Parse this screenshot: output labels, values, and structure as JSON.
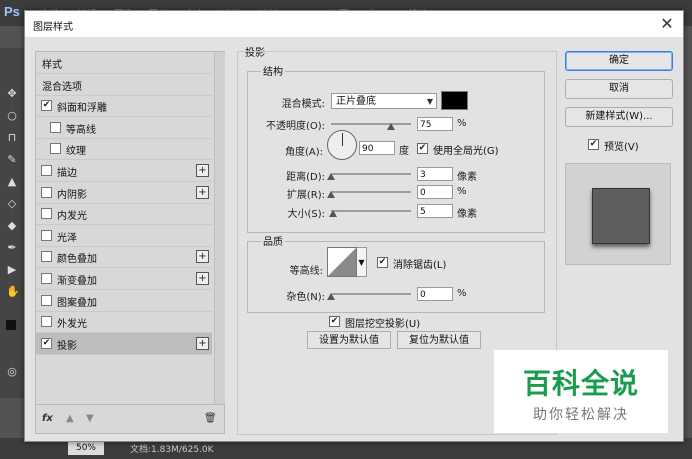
{
  "background_app": {
    "logo": "Ps",
    "menu": "文件(F)  编辑(E)  图像(I)  图层(L)  文字(Y)  选择(S)  滤镜(T)  3D(D)  视图(V)  窗口(W)  帮助(H)",
    "zoom": "50%",
    "doc_info": "文档:1.83M/625.0K"
  },
  "dialog": {
    "title": "图层样式",
    "close_glyph": "✕"
  },
  "sidebar": {
    "items": [
      {
        "label": "样式",
        "has_checkbox": false,
        "checked": false,
        "has_plus": false,
        "selected": false,
        "indent": false
      },
      {
        "label": "混合选项",
        "has_checkbox": false,
        "checked": false,
        "has_plus": false,
        "selected": false,
        "indent": false
      },
      {
        "label": "斜面和浮雕",
        "has_checkbox": true,
        "checked": true,
        "has_plus": false,
        "selected": false,
        "indent": false
      },
      {
        "label": "等高线",
        "has_checkbox": true,
        "checked": false,
        "has_plus": false,
        "selected": false,
        "indent": true
      },
      {
        "label": "纹理",
        "has_checkbox": true,
        "checked": false,
        "has_plus": false,
        "selected": false,
        "indent": true
      },
      {
        "label": "描边",
        "has_checkbox": true,
        "checked": false,
        "has_plus": true,
        "selected": false,
        "indent": false
      },
      {
        "label": "内阴影",
        "has_checkbox": true,
        "checked": false,
        "has_plus": true,
        "selected": false,
        "indent": false
      },
      {
        "label": "内发光",
        "has_checkbox": true,
        "checked": false,
        "has_plus": false,
        "selected": false,
        "indent": false
      },
      {
        "label": "光泽",
        "has_checkbox": true,
        "checked": false,
        "has_plus": false,
        "selected": false,
        "indent": false
      },
      {
        "label": "颜色叠加",
        "has_checkbox": true,
        "checked": false,
        "has_plus": true,
        "selected": false,
        "indent": false
      },
      {
        "label": "渐变叠加",
        "has_checkbox": true,
        "checked": false,
        "has_plus": true,
        "selected": false,
        "indent": false
      },
      {
        "label": "图案叠加",
        "has_checkbox": true,
        "checked": false,
        "has_plus": false,
        "selected": false,
        "indent": false
      },
      {
        "label": "外发光",
        "has_checkbox": true,
        "checked": false,
        "has_plus": false,
        "selected": false,
        "indent": false
      },
      {
        "label": "投影",
        "has_checkbox": true,
        "checked": true,
        "has_plus": true,
        "selected": true,
        "indent": false
      }
    ],
    "footer": {
      "fx": "fx",
      "up": "▲",
      "down": "▼",
      "trash": "🗑"
    }
  },
  "panel": {
    "section_title": "投影",
    "structure": {
      "title": "结构",
      "blend_mode_label": "混合模式:",
      "blend_mode_value": "正片叠底",
      "shadow_color": "#000000",
      "opacity_label": "不透明度(O):",
      "opacity_value": "75",
      "opacity_fraction": 0.75,
      "opacity_unit": "%",
      "angle_label": "角度(A):",
      "angle_value": "90",
      "angle_unit": "度",
      "global_light_label": "使用全局光(G)",
      "global_light_checked": true,
      "distance_label": "距离(D):",
      "distance_value": "3",
      "distance_unit": "像素",
      "spread_label": "扩展(R):",
      "spread_value": "0",
      "spread_unit": "%",
      "size_label": "大小(S):",
      "size_value": "5",
      "size_unit": "像素"
    },
    "quality": {
      "title": "品质",
      "contour_label": "等高线:",
      "antialias_label": "消除锯齿(L)",
      "antialias_checked": true,
      "noise_label": "杂色(N):",
      "noise_value": "0",
      "noise_unit": "%"
    },
    "knockout_label": "图层挖空投影(U)",
    "knockout_checked": true,
    "set_default_label": "设置为默认值",
    "reset_default_label": "复位为默认值"
  },
  "right": {
    "ok_label": "确定",
    "cancel_label": "取消",
    "new_style_label": "新建样式(W)...",
    "preview_label": "预览(V)",
    "preview_checked": true
  },
  "watermark": {
    "title": "百科全说",
    "subtitle": "助你轻松解决"
  }
}
